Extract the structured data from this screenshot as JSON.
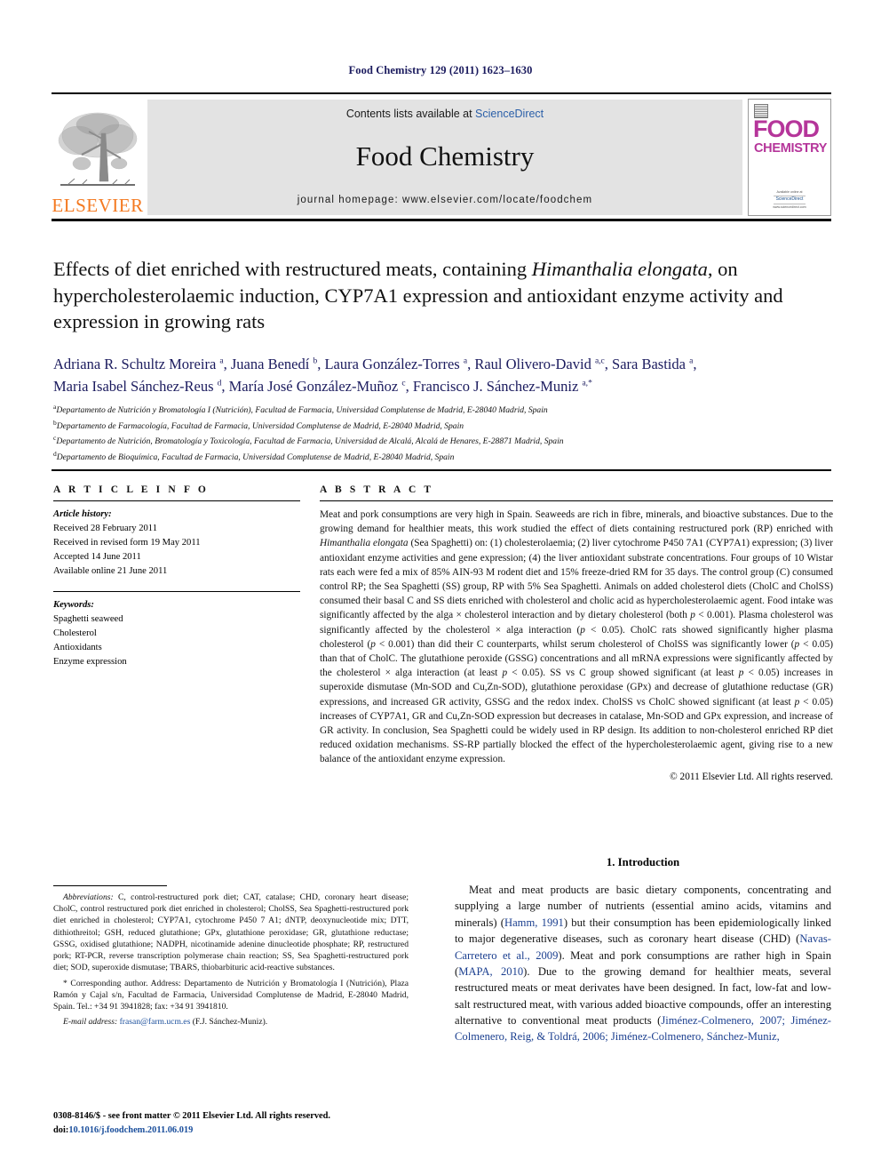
{
  "running_head": "Food Chemistry 129 (2011) 1623–1630",
  "masthead": {
    "publisher_name": "ELSEVIER",
    "contents_prefix": "Contents lists available at ",
    "contents_link": "ScienceDirect",
    "journal_name": "Food Chemistry",
    "homepage": "journal homepage: www.elsevier.com/locate/foodchem",
    "cover": {
      "line1": "FOOD",
      "line2": "CHEMISTRY",
      "sd_top": "Available online at",
      "sd_brand": "ScienceDirect",
      "sd_bottom": "www.sciencedirect.com"
    }
  },
  "title": {
    "part1": "Effects of diet enriched with restructured meats, containing ",
    "italic1": "Himanthalia elongata",
    "part2": ", on hypercholesterolaemic induction, CYP7A1 expression and antioxidant enzyme activity and expression in growing rats"
  },
  "authors_line1": "Adriana R. Schultz Moreira a, Juana Benedí b, Laura González-Torres a, Raul Olivero-David a,c, Sara Bastida a,",
  "authors_line2": "Maria Isabel Sánchez-Reus d, María José González-Muñoz c, Francisco J. Sánchez-Muniz a,*",
  "affiliations": [
    {
      "marker": "a",
      "text": "Departamento de Nutrición y Bromatología I (Nutrición), Facultad de Farmacia, Universidad Complutense de Madrid, E-28040 Madrid, Spain"
    },
    {
      "marker": "b",
      "text": "Departamento de Farmacología, Facultad de Farmacia, Universidad Complutense de Madrid, E-28040 Madrid, Spain"
    },
    {
      "marker": "c",
      "text": "Departamento de Nutrición, Bromatología y Toxicología, Facultad de Farmacia, Universidad de Alcalá, Alcalá de Henares, E-28871 Madrid, Spain"
    },
    {
      "marker": "d",
      "text": "Departamento de Bioquímica, Facultad de Farmacia, Universidad Complutense de Madrid, E-28040 Madrid, Spain"
    }
  ],
  "article_info": {
    "heading": "A R T I C L E    I N F O",
    "history_label": "Article history:",
    "history": [
      "Received 28 February 2011",
      "Received in revised form 19 May 2011",
      "Accepted 14 June 2011",
      "Available online 21 June 2011"
    ],
    "keywords_label": "Keywords:",
    "keywords": [
      "Spaghetti seaweed",
      "Cholesterol",
      "Antioxidants",
      "Enzyme expression"
    ]
  },
  "abstract": {
    "heading": "A B S T R A C T",
    "seg1": "Meat and pork consumptions are very high in Spain. Seaweeds are rich in fibre, minerals, and bioactive substances. Due to the growing demand for healthier meats, this work studied the effect of diets containing restructured pork (RP) enriched with ",
    "italic1": "Himanthalia elongata",
    "seg2": " (Sea Spaghetti) on: (1) cholesterolaemia; (2) liver cytochrome P450 7A1 (CYP7A1) expression; (3) liver antioxidant enzyme activities and gene expression; (4) the liver antioxidant substrate concentrations. Four groups of 10 Wistar rats each were fed a mix of 85% AIN-93 M rodent diet and 15% freeze-dried RM for 35 days. The control group (C) consumed control RP; the Sea Spaghetti (SS) group, RP with 5% Sea Spaghetti. Animals on added cholesterol diets (CholC and CholSS) consumed their basal C and SS diets enriched with cholesterol and cholic acid as hypercholesterolaemic agent. Food intake was significantly affected by the alga × cholesterol interaction and by dietary cholesterol (both ",
    "italic2": "p",
    "seg3": " < 0.001). Plasma cholesterol was significantly affected by the cholesterol × alga interaction (",
    "italic3": "p",
    "seg4": " < 0.05). CholC rats showed significantly higher plasma cholesterol (",
    "italic4": "p",
    "seg5": " < 0.001) than did their C counterparts, whilst serum cholesterol of CholSS was significantly lower (",
    "italic5": "p",
    "seg6": " < 0.05) than that of CholC. The glutathione peroxide (GSSG) concentrations and all mRNA expressions were significantly affected by the cholesterol × alga interaction (at least ",
    "italic6": "p",
    "seg7": " < 0.05). SS vs C group showed significant (at least ",
    "italic7": "p",
    "seg8": " < 0.05) increases in superoxide dismutase (Mn-SOD and Cu,Zn-SOD), glutathione peroxidase (GPx) and decrease of glutathione reductase (GR) expressions, and increased GR activity, GSSG and the redox index. CholSS vs CholC showed significant (at least ",
    "italic8": "p",
    "seg9": " < 0.05) increases of CYP7A1, GR and Cu,Zn-SOD expression but decreases in catalase, Mn-SOD and GPx expression, and increase of GR activity. In conclusion, Sea Spaghetti could be widely used in RP design. Its addition to non-cholesterol enriched RP diet reduced oxidation mechanisms. SS-RP partially blocked the effect of the hypercholesterolaemic agent, giving rise to a new balance of the antioxidant enzyme expression.",
    "copyright": "© 2011 Elsevier Ltd. All rights reserved."
  },
  "footnotes": {
    "abbrev_label": "Abbreviations:",
    "abbrev_text": " C, control-restructured pork diet; CAT, catalase; CHD, coronary heart disease; CholC, control restructured pork diet enriched in cholesterol; CholSS, Sea Spaghetti-restructured pork diet enriched in cholesterol; CYP7A1, cytochrome P450 7 A1; dNTP, deoxynucleotide mix; DTT, dithiothreitol; GSH, reduced glutathione; GPx, glutathione peroxidase; GR, glutathione reductase; GSSG, oxidised glutathione; NADPH, nicotinamide adenine dinucleotide phosphate; RP, restructured pork; RT-PCR, reverse transcription polymerase chain reaction; SS, Sea Spaghetti-restructured pork diet; SOD, superoxide dismutase; TBARS, thiobarbituric acid-reactive substances.",
    "corresponding_marker": "*",
    "corresponding_text": " Corresponding author. Address: Departamento de Nutrición y Bromatología I (Nutrición), Plaza Ramón y Cajal s/n, Facultad de Farmacia, Universidad Complutense de Madrid, E-28040 Madrid, Spain. Tel.: +34 91 3941828; fax: +34 91 3941810.",
    "email_label": "E-mail address:",
    "email_address": "frasan@farm.ucm.es",
    "email_suffix": " (F.J. Sánchez-Muniz)."
  },
  "issn": {
    "line1": "0308-8146/$ - see front matter © 2011 Elsevier Ltd. All rights reserved.",
    "doi_prefix": "doi:",
    "doi": "10.1016/j.foodchem.2011.06.019"
  },
  "introduction": {
    "heading": "1. Introduction",
    "seg1": "Meat and meat products are basic dietary components, concentrating and supplying a large number of nutrients (essential amino acids, vitamins and minerals) (",
    "cite1": "Hamm, 1991",
    "seg2": ") but their consumption has been epidemiologically linked to major degenerative diseases, such as coronary heart disease (CHD) (",
    "cite2": "Navas-Carretero et al., 2009",
    "seg3": "). Meat and pork consumptions are rather high in Spain (",
    "cite3": "MAPA, 2010",
    "seg4": "). Due to the growing demand for healthier meats, several restructured meats or meat derivates have been designed. In fact, low-fat and low-salt restructured meat, with various added bioactive compounds, offer an interesting alternative to conventional meat products (",
    "cite4": "Jiménez-Colmenero, 2007; Jiménez-Colmenero, Reig, & Toldrá, 2006; Jiménez-Colmenero, Sánchez-Muniz,",
    "seg5": ""
  }
}
